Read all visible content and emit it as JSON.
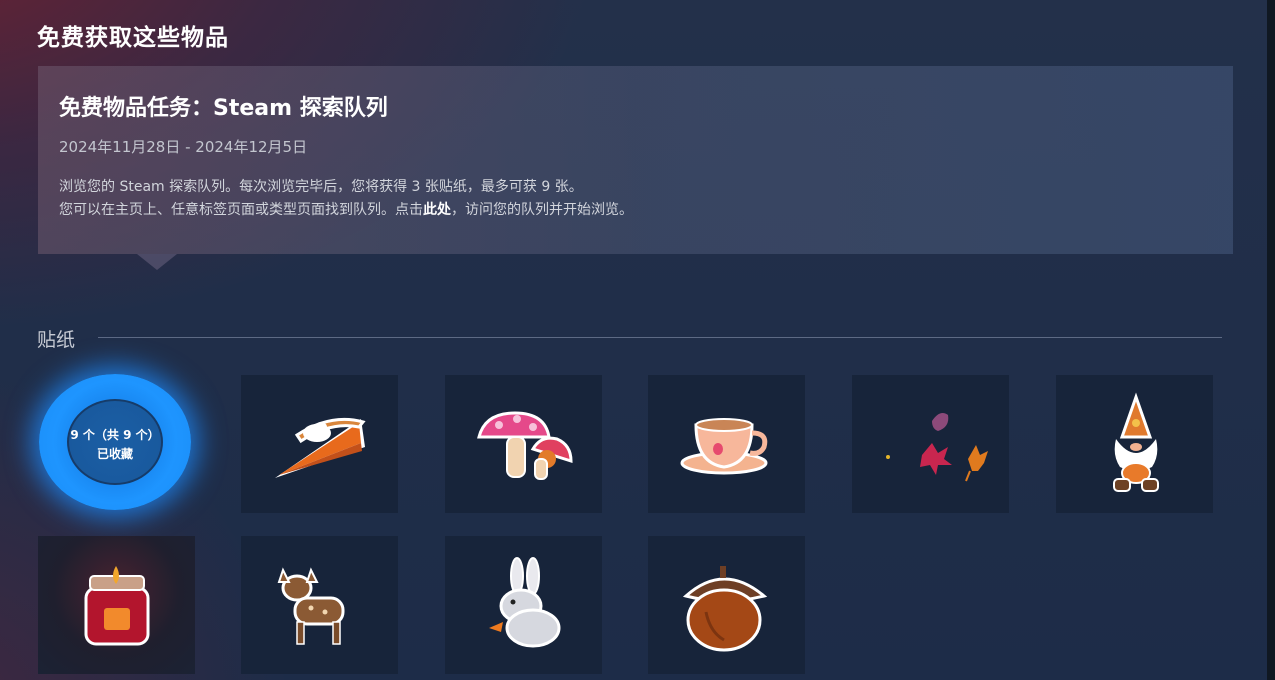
{
  "page": {
    "section_title": "免费获取这些物品"
  },
  "event": {
    "title": "免费物品任务：Steam 探索队列",
    "date_range": "2024年11月28日 - 2024年12月5日",
    "description_line1": "浏览您的 Steam 探索队列。每次浏览完毕后，您将获得 3 张贴纸，最多可获 9 张。",
    "description_line2_prefix": "您可以在主页上、任意标签页面或类型页面找到队列。点击",
    "description_link": "此处",
    "description_line2_suffix": "，访问您的队列并开始浏览。"
  },
  "stickers": {
    "category_label": "贴纸",
    "progress": {
      "count_text": "9 个（共 9 个）",
      "status_text": "已收藏",
      "collected": 9,
      "total": 9
    },
    "items": [
      {
        "icon": "pumpkin-pie-icon"
      },
      {
        "icon": "mushrooms-icon"
      },
      {
        "icon": "teacup-icon"
      },
      {
        "icon": "falling-leaves-icon"
      },
      {
        "icon": "gnome-icon"
      },
      {
        "icon": "candle-jar-icon"
      },
      {
        "icon": "fawn-icon"
      },
      {
        "icon": "rabbit-icon"
      },
      {
        "icon": "acorn-icon"
      }
    ]
  },
  "colors": {
    "accent_blue": "#1e95ff",
    "tile_bg": "#17243a",
    "page_bg": "#1d2c48"
  }
}
